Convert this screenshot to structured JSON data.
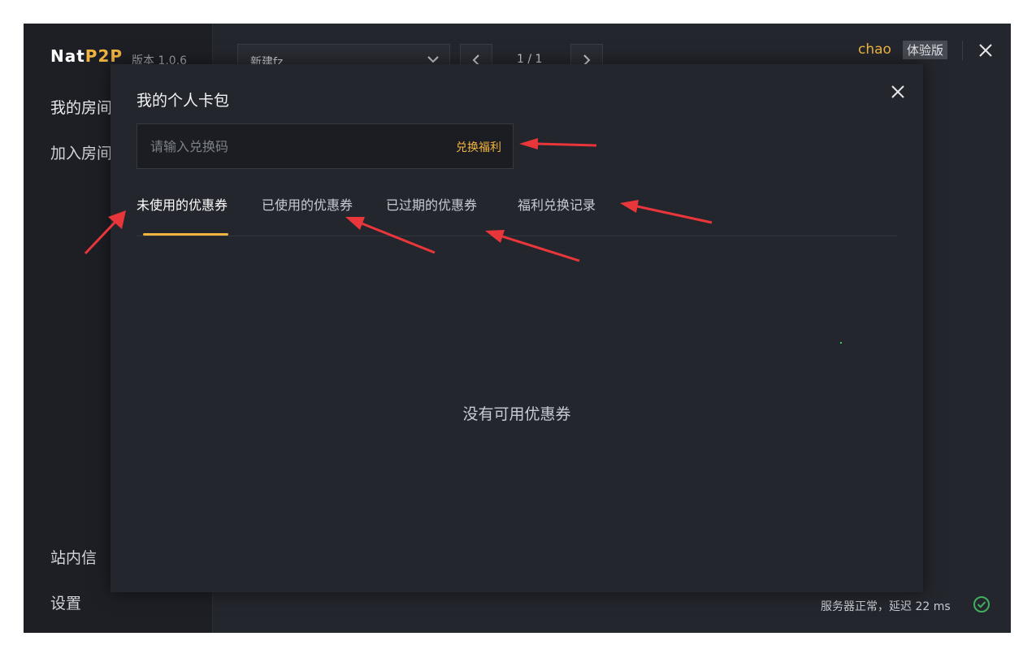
{
  "app": {
    "logo": {
      "part1": "Nat",
      "part2": "P2P"
    },
    "version": "版本 1.0.6",
    "sidebar": {
      "my_room": "我的房间",
      "join_room": "加入房间",
      "inbox": "站内信",
      "settings": "设置"
    },
    "topbar": {
      "selected_room": "新建fz",
      "page": "1 / 1"
    },
    "user": {
      "name": "chao",
      "badge": "体验版"
    },
    "status": {
      "text": "服务器正常，延迟 22 ms"
    }
  },
  "modal": {
    "title": "我的个人卡包",
    "redeem_placeholder": "请输入兑换码",
    "redeem_button": "兑换福利",
    "tabs": [
      "未使用的优惠券",
      "已使用的优惠券",
      "已过期的优惠券",
      "福利兑换记录"
    ],
    "active_tab": 0,
    "empty_text": "没有可用优惠券"
  },
  "colors": {
    "accent": "#f0b43f",
    "annotation_arrow": "#e8363a",
    "status_ok": "#3fae5e"
  }
}
